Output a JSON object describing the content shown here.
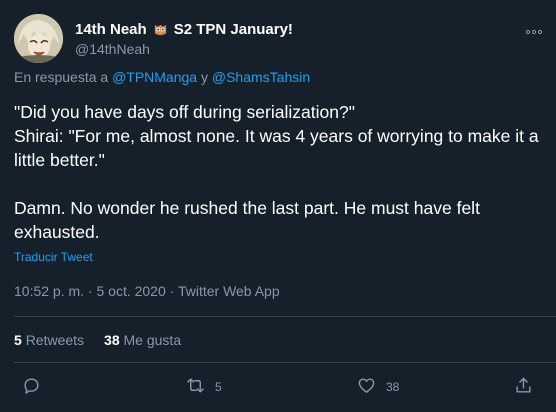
{
  "author": {
    "display_name_part1": "14th Neah",
    "display_name_part2": "S2 TPN January!",
    "handle": "@14thNeah",
    "owl_color": "#e8a05c"
  },
  "reply_to": {
    "prefix": "En respuesta a",
    "user1": "@TPNManga",
    "conjunction": "y",
    "user2": "@ShamsTahsin"
  },
  "tweet": {
    "line1": "\"Did you have days off during serialization?\"",
    "line2": "Shirai: \"For me, almost none. It was 4 years of worrying to make it a little better.\"",
    "line3": "Damn. No wonder he rushed the last part. He must have felt exhausted.",
    "translate_label": "Traducir Tweet",
    "timestamp": "10:52 p. m. · 5 oct. 2020 · Twitter Web App"
  },
  "stats": {
    "retweets_count": "5",
    "retweets_label": "Retweets",
    "likes_count": "38",
    "likes_label": "Me gusta"
  },
  "actions": {
    "reply_icon": "reply-icon",
    "retweet_icon": "retweet-icon",
    "retweet_count": "5",
    "like_icon": "heart-icon",
    "like_count": "38",
    "share_icon": "share-icon"
  },
  "colors": {
    "background": "#15202b",
    "accent": "#1da1f2",
    "muted": "#8899a6",
    "divider": "#38444d"
  }
}
